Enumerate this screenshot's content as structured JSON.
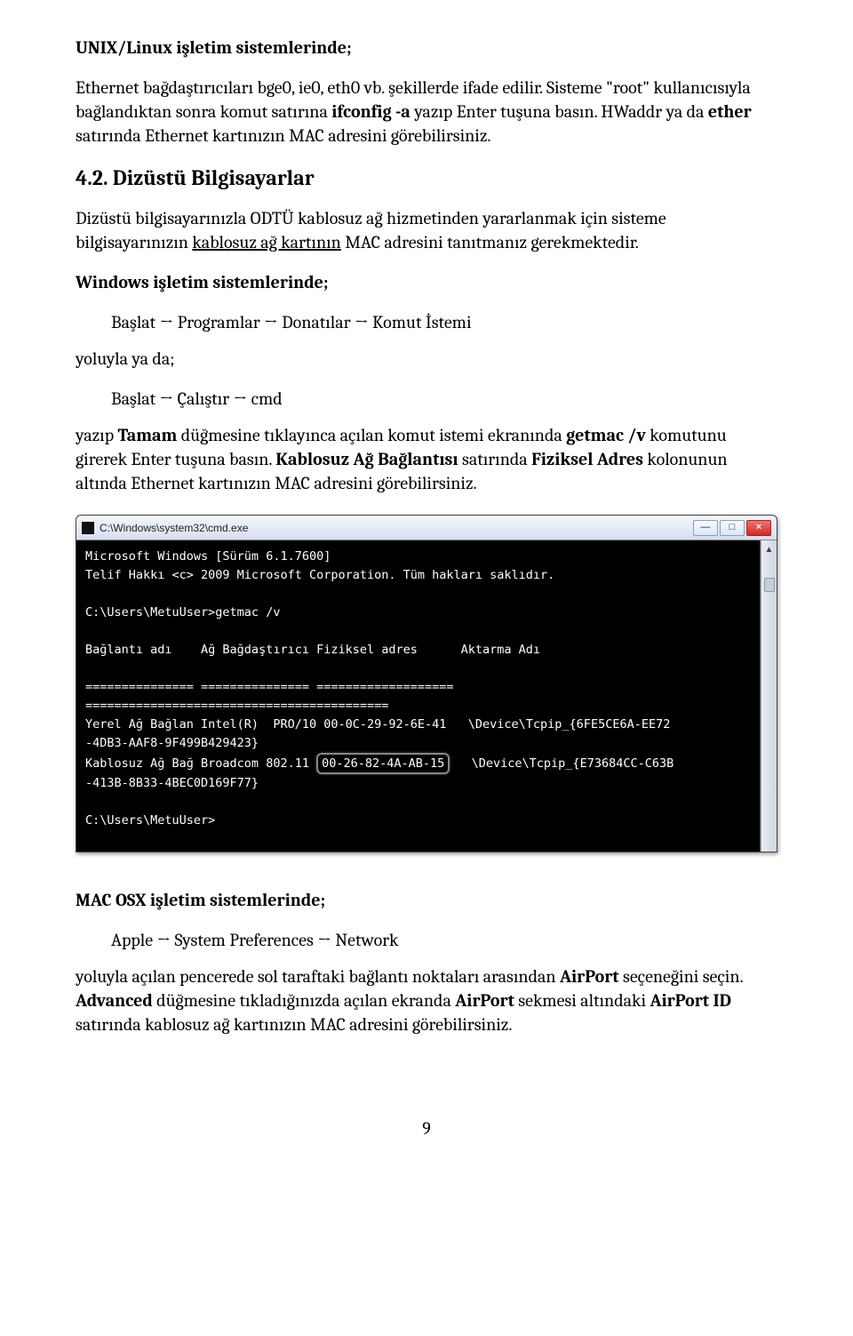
{
  "doc": {
    "unix_heading": "UNIX/Linux işletim sistemlerinde;",
    "unix_p1a": "Ethernet bağdaştırıcıları bge0, ie0, eth0 vb. şekillerde ifade edilir. Sisteme \"root\" kullanıcısıyla bağlandıktan sonra komut satırına ",
    "unix_p1_bold1": "ifconfig -a",
    "unix_p1b": " yazıp Enter tuşuna basın. HWaddr ya da ",
    "unix_p1_bold2": "ether",
    "unix_p1c": " satırında Ethernet kartınızın MAC adresini görebilirsiniz.",
    "sec42": "4.2.    Dizüstü Bilgisayarlar",
    "p42a": "Dizüstü bilgisayarınızla ODTÜ kablosuz ağ hizmetinden yararlanmak için sisteme bilgisayarınızın ",
    "p42_ul": "kablosuz ağ kartının",
    "p42b": " MAC adresini tanıtmanız gerekmektedir.",
    "win_heading": "Windows işletim sistemlerinde;",
    "nav1": "Başlat → Programlar → Donatılar → Komut İstemi",
    "yol": "yoluyla ya da;",
    "nav2": "Başlat → Çalıştır → cmd",
    "para2a": "yazıp ",
    "para2_b1": "Tamam",
    "para2b": " düğmesine tıklayınca açılan komut istemi ekranında ",
    "para2_b2": "getmac /v",
    "para2c": " komutunu girerek Enter tuşuna basın. ",
    "para2_b3": "Kablosuz Ağ Bağlantısı",
    "para2d": " satırında ",
    "para2_b4": "Fiziksel Adres",
    "para2e": " kolonunun altında Ethernet kartınızın MAC adresini görebilirsiniz.",
    "mac_heading": "MAC OSX işletim sistemlerinde;",
    "nav3": "Apple → System Preferences → Network",
    "mac_p1a": "yoluyla açılan pencerede sol taraftaki bağlantı noktaları arasından ",
    "mac_b1": "AirPort",
    "mac_p1b": " seçeneğini seçin. ",
    "mac_b2": "Advanced",
    "mac_p1c": " düğmesine tıkladığınızda açılan ekranda ",
    "mac_b3": "AirPort",
    "mac_p1d": " sekmesi altındaki ",
    "mac_b4": "AirPort ID",
    "mac_p1e": " satırında kablosuz ağ kartınızın MAC adresini görebilirsiniz.",
    "page": "9"
  },
  "cmd": {
    "title": "C:\\Windows\\system32\\cmd.exe",
    "l1": "Microsoft Windows [Sürüm 6.1.7600]",
    "l2": "Telif Hakkı <c> 2009 Microsoft Corporation. Tüm hakları saklıdır.",
    "l3": "C:\\Users\\MetuUser>getmac /v",
    "hdr": "Bağlantı adı    Ağ Bağdaştırıcı Fiziksel adres      Aktarma Adı",
    "sep1": "=============== =============== =================== ==========================================",
    "row1a": "Yerel Ağ Bağlan Intel(R)  PRO/10 00-0C-29-92-6E-41   \\Device\\Tcpip_{6FE5CE6A-EE72",
    "row1b": "-4DB3-AAF8-9F499B429423}",
    "row2a": "Kablosuz Ağ Bağ Broadcom 802.11 ",
    "row2_mac": "00-26-82-4A-AB-15",
    "row2b": "   \\Device\\Tcpip_{E73684CC-C63B",
    "row2c": "-413B-8B33-4BEC0D169F77}",
    "prompt": "C:\\Users\\MetuUser>"
  }
}
